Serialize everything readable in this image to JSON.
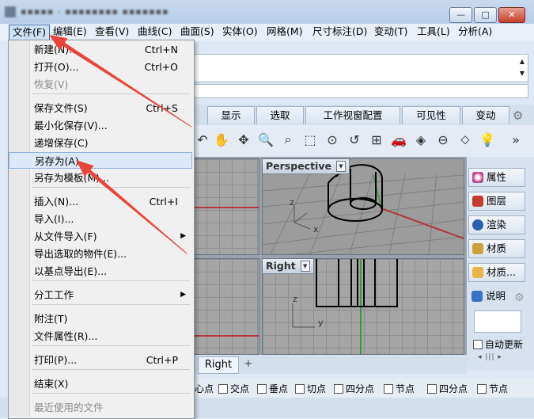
{
  "window": {
    "title": "▪▪▪▪▪ - ▪▪▪▪▪▪▪▪ ▪▪▪▪▪▪▪",
    "minimize": "—",
    "maximize": "□",
    "close": "✕"
  },
  "menubar": [
    "文件(F)",
    "编辑(E)",
    "查看(V)",
    "曲线(C)",
    "曲面(S)",
    "实体(O)",
    "网格(M)",
    "尺寸标注(D)",
    "变动(T)",
    "工具(L)",
    "分析(A)"
  ],
  "tabs": [
    "显示",
    "选取",
    "工作视窗配置",
    "可见性",
    "变动"
  ],
  "toolbar_more": "»",
  "viewports": {
    "top_right_label": "Perspective",
    "bottom_right_label": "Right",
    "axis_z": "z",
    "axis_x": "x",
    "axis_y": "y"
  },
  "viewport_tabs": {
    "active": "Right",
    "add": "+"
  },
  "panels": [
    "属性",
    "图层",
    "渲染",
    "材质",
    "材质...",
    "说明"
  ],
  "panel_colors": [
    "#d24a8c",
    "#c43b2f",
    "#2b5fb0",
    "#c9a23a",
    "#e8b54a",
    "#3a73c4"
  ],
  "auto_update": "自动更新",
  "panel_scroll": "◂ ||| ▸",
  "osnaps": [
    "心点",
    "交点",
    "垂点",
    "切点",
    "四分点",
    "节点",
    "四分点",
    "节点"
  ],
  "file_menu": [
    {
      "label": "新建(N)...",
      "shortcut": "Ctrl+N",
      "disabled": false
    },
    {
      "label": "打开(O)...",
      "shortcut": "Ctrl+O",
      "disabled": false
    },
    {
      "label": "恢复(V)",
      "shortcut": "",
      "disabled": true
    },
    {
      "label": "保存文件(S)",
      "shortcut": "Ctrl+S",
      "disabled": false
    },
    {
      "label": "最小化保存(V)...",
      "shortcut": "",
      "disabled": false
    },
    {
      "label": "递增保存(C)",
      "shortcut": "",
      "disabled": false
    },
    {
      "label": "另存为(A)...",
      "shortcut": "",
      "disabled": false,
      "highlighted": true
    },
    {
      "label": "另存为模板(M)...",
      "shortcut": "",
      "disabled": false
    },
    {
      "label": "插入(N)...",
      "shortcut": "Ctrl+I",
      "disabled": false
    },
    {
      "label": "导入(I)...",
      "shortcut": "",
      "disabled": false
    },
    {
      "label": "从文件导入(F)",
      "shortcut": "",
      "submenu": true
    },
    {
      "label": "导出选取的物件(E)...",
      "shortcut": "",
      "disabled": false
    },
    {
      "label": "以基点导出(E)...",
      "shortcut": "",
      "disabled": false
    },
    {
      "label": "分工工作",
      "shortcut": "",
      "submenu": true
    },
    {
      "label": "附注(T)",
      "shortcut": "",
      "disabled": false
    },
    {
      "label": "文件属性(R)...",
      "shortcut": "",
      "disabled": false
    },
    {
      "label": "打印(P)...",
      "shortcut": "Ctrl+P",
      "disabled": false
    },
    {
      "label": "结束(X)",
      "shortcut": "",
      "disabled": false
    },
    {
      "label": "最近使用的文件",
      "shortcut": "",
      "disabled": true
    }
  ],
  "submenu_arrow": "▶",
  "annotation_color": "#e8453a"
}
